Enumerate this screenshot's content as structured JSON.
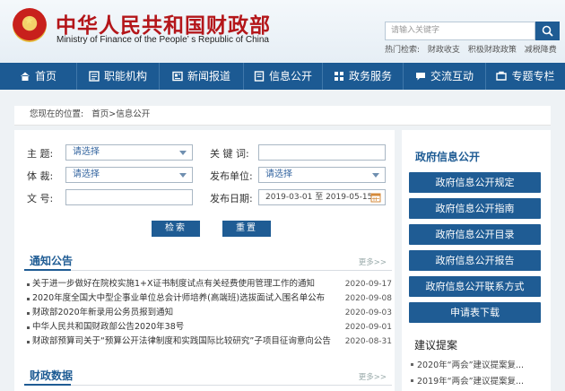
{
  "header": {
    "title": "中华人民共和国财政部",
    "subtitle": "Ministry of Finance of the People’ s Republic of China",
    "search_placeholder": "请输入关键字",
    "hot_label": "热门检索:",
    "hot_items": [
      "财政收支",
      "积极财政政策",
      "减税降费"
    ]
  },
  "nav": {
    "items": [
      {
        "label": "首页",
        "icon": "home-icon"
      },
      {
        "label": "职能机构",
        "icon": "org-icon"
      },
      {
        "label": "新闻报道",
        "icon": "news-icon"
      },
      {
        "label": "信息公开",
        "icon": "info-icon"
      },
      {
        "label": "政务服务",
        "icon": "service-icon"
      },
      {
        "label": "交流互动",
        "icon": "exchange-icon"
      },
      {
        "label": "专题专栏",
        "icon": "topic-icon"
      }
    ]
  },
  "breadcrumb": {
    "prefix": "您现在的位置:",
    "path": "首页>信息公开"
  },
  "form": {
    "topic_label": "主    题:",
    "topic_value": "请选择",
    "keyword_label": "关 键 词:",
    "keyword_value": "",
    "genre_label": "体    裁:",
    "genre_value": "请选择",
    "unit_label": "发布单位:",
    "unit_value": "请选择",
    "doc_label": "文    号:",
    "doc_value": "",
    "date_label": "发布日期:",
    "date_from": "2019-03-01",
    "date_sep": "至",
    "date_to": "2019-05-15",
    "search_btn": "检索",
    "reset_btn": "重置"
  },
  "notices": {
    "title": "通知公告",
    "more": "更多>>",
    "items": [
      {
        "text": "关于进一步做好在院校实施1+X证书制度试点有关经费使用管理工作的通知",
        "date": "2020-09-17"
      },
      {
        "text": "2020年度全国大中型企事业单位总会计师培养(高端班)选拔面试入围名单公布",
        "date": "2020-09-08"
      },
      {
        "text": "财政部2020年新录用公务员报到通知",
        "date": "2020-09-03"
      },
      {
        "text": "中华人民共和国财政部公告2020年38号",
        "date": "2020-09-01"
      },
      {
        "text": "财政部预算司关于“预算公开法律制度和实践国际比较研究”子项目征询意向公告",
        "date": "2020-08-31"
      }
    ]
  },
  "fiscal": {
    "title": "财政数据",
    "more": "更多>>"
  },
  "sidebar": {
    "title": "政府信息公开",
    "buttons": [
      "政府信息公开规定",
      "政府信息公开指南",
      "政府信息公开目录",
      "政府信息公开报告",
      "政府信息公开联系方式",
      "申请表下载"
    ],
    "suggestion_title": "建议提案",
    "suggestions": [
      "2020年“两会”建议提案复...",
      "2019年“两会”建议提案复..."
    ]
  },
  "colors": {
    "primary": "#1f5c94",
    "brand_red": "#b4161a"
  }
}
